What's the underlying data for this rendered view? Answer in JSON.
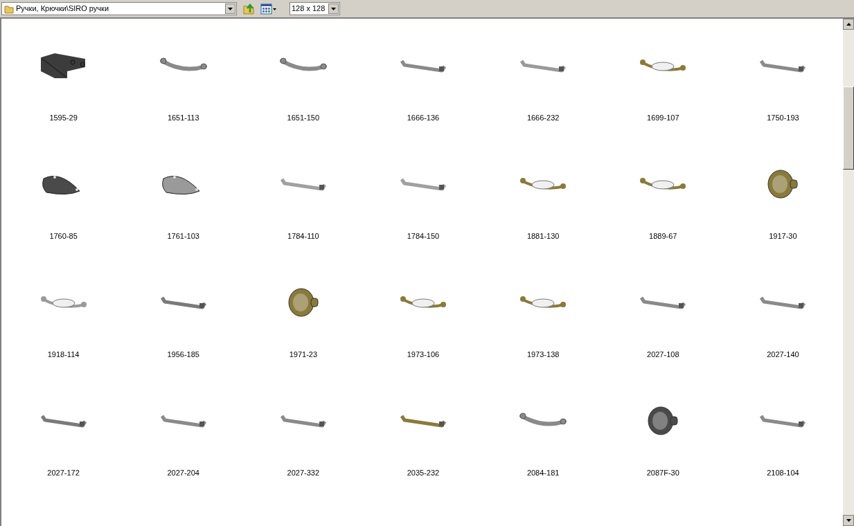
{
  "toolbar": {
    "path": "Ручки, Крючки\\SIRO ручки",
    "size": "128 x 128"
  },
  "items": [
    {
      "label": "1595-29",
      "kind": "block",
      "color": "#3c3c3c"
    },
    {
      "label": "1651-113",
      "kind": "bow",
      "color": "#8a8a8a"
    },
    {
      "label": "1651-150",
      "kind": "bow",
      "color": "#8a8a8a"
    },
    {
      "label": "1666-136",
      "kind": "bar",
      "color": "#8a8a8a"
    },
    {
      "label": "1666-232",
      "kind": "bar",
      "color": "#9a9a9a"
    },
    {
      "label": "1699-107",
      "kind": "ceramic",
      "color": "#8a7a3a"
    },
    {
      "label": "1750-193",
      "kind": "bar",
      "color": "#8a8a8a"
    },
    {
      "label": "1760-85",
      "kind": "cup",
      "color": "#4a4a4a"
    },
    {
      "label": "1761-103",
      "kind": "cup",
      "color": "#9a9a9a"
    },
    {
      "label": "1784-110",
      "kind": "bar",
      "color": "#a0a0a0"
    },
    {
      "label": "1784-150",
      "kind": "bar",
      "color": "#a0a0a0"
    },
    {
      "label": "1881-130",
      "kind": "ceramic",
      "color": "#8a7a3a"
    },
    {
      "label": "1889-67",
      "kind": "ceramic",
      "color": "#8a7a3a"
    },
    {
      "label": "1917-30",
      "kind": "knob",
      "color": "#8a7a3a"
    },
    {
      "label": "1918-114",
      "kind": "ceramic",
      "color": "#9a9a9a"
    },
    {
      "label": "1956-185",
      "kind": "bar",
      "color": "#7a7a7a"
    },
    {
      "label": "1971-23",
      "kind": "knob",
      "color": "#8a7a3a"
    },
    {
      "label": "1973-106",
      "kind": "ceramic",
      "color": "#8a7a3a"
    },
    {
      "label": "1973-138",
      "kind": "ceramic",
      "color": "#8a7a3a"
    },
    {
      "label": "2027-108",
      "kind": "bar",
      "color": "#8a8a8a"
    },
    {
      "label": "2027-140",
      "kind": "bar",
      "color": "#8a8a8a"
    },
    {
      "label": "2027-172",
      "kind": "bar",
      "color": "#7a7a7a"
    },
    {
      "label": "2027-204",
      "kind": "bar",
      "color": "#8a8a8a"
    },
    {
      "label": "2027-332",
      "kind": "bar",
      "color": "#8a8a8a"
    },
    {
      "label": "2035-232",
      "kind": "bar",
      "color": "#8a7a3a"
    },
    {
      "label": "2084-181",
      "kind": "bow",
      "color": "#8a8a8a"
    },
    {
      "label": "2087F-30",
      "kind": "knob",
      "color": "#4a4a4a"
    },
    {
      "label": "2108-104",
      "kind": "bar",
      "color": "#8a8a8a"
    }
  ]
}
